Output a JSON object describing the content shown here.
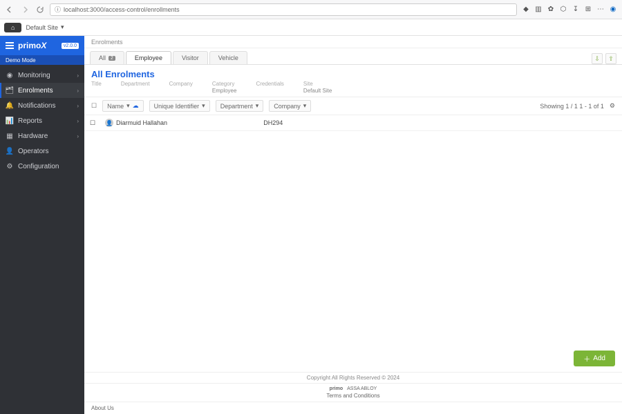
{
  "browser": {
    "url": "localhost:3000/access-control/enrollments"
  },
  "topbar": {
    "home": "⌂",
    "site_label": "Default Site"
  },
  "brand": {
    "name": "primo",
    "suffix": "X",
    "version": "v2.0.0",
    "mode": "Demo Mode"
  },
  "sidebar": [
    {
      "icon": "monitor",
      "label": "Monitoring",
      "has_children": true,
      "active": false
    },
    {
      "icon": "enrol",
      "label": "Enrolments",
      "has_children": true,
      "active": true
    },
    {
      "icon": "bell",
      "label": "Notifications",
      "has_children": true,
      "active": false
    },
    {
      "icon": "report",
      "label": "Reports",
      "has_children": true,
      "active": false
    },
    {
      "icon": "chip",
      "label": "Hardware",
      "has_children": true,
      "active": false
    },
    {
      "icon": "user",
      "label": "Operators",
      "has_children": false,
      "active": false
    },
    {
      "icon": "gear",
      "label": "Configuration",
      "has_children": false,
      "active": false
    }
  ],
  "breadcrumb": "Enrolments",
  "tabs": [
    {
      "label": "All",
      "count": "2",
      "active": false
    },
    {
      "label": "Employee",
      "count": "",
      "active": true
    },
    {
      "label": "Visitor",
      "count": "",
      "active": false
    },
    {
      "label": "Vehicle",
      "count": "",
      "active": false
    }
  ],
  "heading": "All Enrolments",
  "meta": [
    {
      "label": "Title",
      "value": ""
    },
    {
      "label": "Department",
      "value": ""
    },
    {
      "label": "Company",
      "value": ""
    },
    {
      "label": "Category",
      "value": "Employee"
    },
    {
      "label": "Credentials",
      "value": ""
    },
    {
      "label": "Site",
      "value": "Default Site"
    }
  ],
  "toolbar": {
    "name_col": "Name",
    "uid_col": "Unique Identifier",
    "dept_col": "Department",
    "comp_col": "Company",
    "paging": "Showing  1 / 1   1 - 1 of 1"
  },
  "rows": [
    {
      "name": "Diarmuid Hallahan",
      "uid": "DH294"
    }
  ],
  "add_label": "Add",
  "footer": {
    "copyright": "Copyright All Rights Reserved © 2024",
    "logo1": "primo",
    "logo2": "ASSA ABLOY",
    "terms": "Terms and Conditions",
    "about": "About Us"
  }
}
